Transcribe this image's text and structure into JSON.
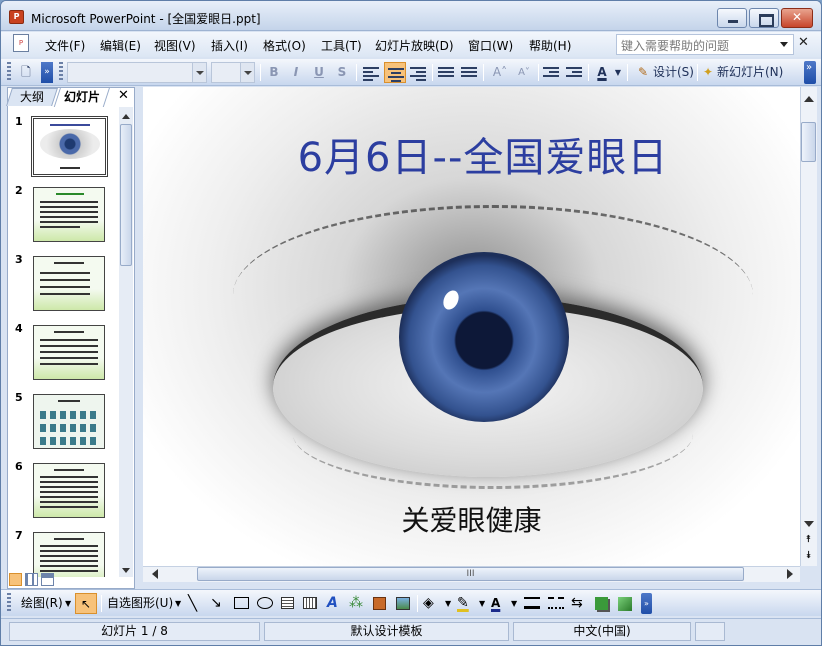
{
  "window": {
    "title": "Microsoft PowerPoint - [全国爱眼日.ppt]",
    "app_icon": "P"
  },
  "menu": {
    "items": [
      {
        "label": "文件(F)"
      },
      {
        "label": "编辑(E)"
      },
      {
        "label": "视图(V)"
      },
      {
        "label": "插入(I)"
      },
      {
        "label": "格式(O)"
      },
      {
        "label": "工具(T)"
      },
      {
        "label": "幻灯片放映(D)"
      },
      {
        "label": "窗口(W)"
      },
      {
        "label": "帮助(H)"
      }
    ],
    "help_placeholder": "键入需要帮助的问题",
    "close_glyph": "✕"
  },
  "toolbar": {
    "bold": "B",
    "italic": "I",
    "underline": "U",
    "shadow": "S",
    "grow_font": "A˄",
    "shrink_font": "A˅",
    "font_color_glyph": "A",
    "design_label": "设计(S)",
    "new_slide_label": "新幻灯片(N)"
  },
  "left_pane": {
    "tabs": {
      "outline": "大纲",
      "slides": "幻灯片"
    },
    "close_glyph": "✕",
    "thumbs": [
      {
        "num": "1"
      },
      {
        "num": "2"
      },
      {
        "num": "3"
      },
      {
        "num": "4"
      },
      {
        "num": "5"
      },
      {
        "num": "6"
      },
      {
        "num": "7"
      }
    ]
  },
  "slide": {
    "title": "6月6日--全国爱眼日",
    "subtitle": "关爱眼健康"
  },
  "scroll": {
    "hscroll_grip": "III",
    "prev_glyph": "⯭",
    "next_glyph": "⯯"
  },
  "drawbar": {
    "draw_label": "绘图(R)",
    "autoshape_label": "自选图形(U)",
    "text_glyph": "A"
  },
  "status": {
    "slide_pos": "幻灯片 1 / 8",
    "template": "默认设计模板",
    "language": "中文(中国)"
  },
  "colors": {
    "title": "#2c3ea0",
    "accent": "#f7c27a",
    "window": "#d9e3f2"
  }
}
